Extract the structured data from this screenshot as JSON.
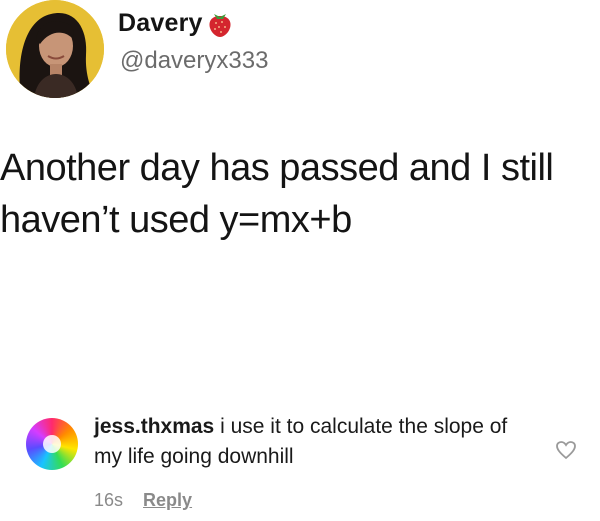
{
  "tweet": {
    "display_name": "Davery",
    "name_emoji_icon": "strawberry-icon",
    "handle": "@daveryx333",
    "text_line1": "Another day has passed and I still",
    "text_line2": "haven’t used y=mx+b"
  },
  "comment": {
    "username": "jess.thxmas",
    "text": "i use it to calculate the slope of my life going downhill",
    "time": "16s",
    "reply_label": "Reply",
    "like_icon": "heart-outline-icon"
  },
  "colors": {
    "text_primary": "#141414",
    "text_secondary": "#6b6b6b",
    "meta_gray": "#8a8a8a",
    "background": "#ffffff"
  }
}
